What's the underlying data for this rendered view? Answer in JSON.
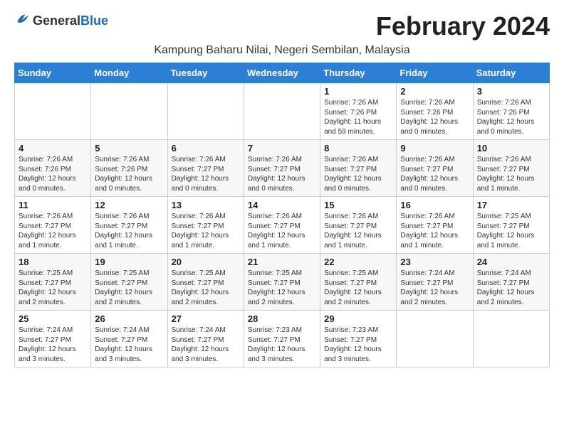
{
  "header": {
    "logo_general": "General",
    "logo_blue": "Blue",
    "month_title": "February 2024",
    "location": "Kampung Baharu Nilai, Negeri Sembilan, Malaysia"
  },
  "days_of_week": [
    "Sunday",
    "Monday",
    "Tuesday",
    "Wednesday",
    "Thursday",
    "Friday",
    "Saturday"
  ],
  "weeks": [
    [
      {
        "day": "",
        "info": ""
      },
      {
        "day": "",
        "info": ""
      },
      {
        "day": "",
        "info": ""
      },
      {
        "day": "",
        "info": ""
      },
      {
        "day": "1",
        "info": "Sunrise: 7:26 AM\nSunset: 7:26 PM\nDaylight: 11 hours\nand 59 minutes."
      },
      {
        "day": "2",
        "info": "Sunrise: 7:26 AM\nSunset: 7:26 PM\nDaylight: 12 hours\nand 0 minutes."
      },
      {
        "day": "3",
        "info": "Sunrise: 7:26 AM\nSunset: 7:26 PM\nDaylight: 12 hours\nand 0 minutes."
      }
    ],
    [
      {
        "day": "4",
        "info": "Sunrise: 7:26 AM\nSunset: 7:26 PM\nDaylight: 12 hours\nand 0 minutes."
      },
      {
        "day": "5",
        "info": "Sunrise: 7:26 AM\nSunset: 7:26 PM\nDaylight: 12 hours\nand 0 minutes."
      },
      {
        "day": "6",
        "info": "Sunrise: 7:26 AM\nSunset: 7:27 PM\nDaylight: 12 hours\nand 0 minutes."
      },
      {
        "day": "7",
        "info": "Sunrise: 7:26 AM\nSunset: 7:27 PM\nDaylight: 12 hours\nand 0 minutes."
      },
      {
        "day": "8",
        "info": "Sunrise: 7:26 AM\nSunset: 7:27 PM\nDaylight: 12 hours\nand 0 minutes."
      },
      {
        "day": "9",
        "info": "Sunrise: 7:26 AM\nSunset: 7:27 PM\nDaylight: 12 hours\nand 0 minutes."
      },
      {
        "day": "10",
        "info": "Sunrise: 7:26 AM\nSunset: 7:27 PM\nDaylight: 12 hours\nand 1 minute."
      }
    ],
    [
      {
        "day": "11",
        "info": "Sunrise: 7:26 AM\nSunset: 7:27 PM\nDaylight: 12 hours\nand 1 minute."
      },
      {
        "day": "12",
        "info": "Sunrise: 7:26 AM\nSunset: 7:27 PM\nDaylight: 12 hours\nand 1 minute."
      },
      {
        "day": "13",
        "info": "Sunrise: 7:26 AM\nSunset: 7:27 PM\nDaylight: 12 hours\nand 1 minute."
      },
      {
        "day": "14",
        "info": "Sunrise: 7:26 AM\nSunset: 7:27 PM\nDaylight: 12 hours\nand 1 minute."
      },
      {
        "day": "15",
        "info": "Sunrise: 7:26 AM\nSunset: 7:27 PM\nDaylight: 12 hours\nand 1 minute."
      },
      {
        "day": "16",
        "info": "Sunrise: 7:26 AM\nSunset: 7:27 PM\nDaylight: 12 hours\nand 1 minute."
      },
      {
        "day": "17",
        "info": "Sunrise: 7:25 AM\nSunset: 7:27 PM\nDaylight: 12 hours\nand 1 minute."
      }
    ],
    [
      {
        "day": "18",
        "info": "Sunrise: 7:25 AM\nSunset: 7:27 PM\nDaylight: 12 hours\nand 2 minutes."
      },
      {
        "day": "19",
        "info": "Sunrise: 7:25 AM\nSunset: 7:27 PM\nDaylight: 12 hours\nand 2 minutes."
      },
      {
        "day": "20",
        "info": "Sunrise: 7:25 AM\nSunset: 7:27 PM\nDaylight: 12 hours\nand 2 minutes."
      },
      {
        "day": "21",
        "info": "Sunrise: 7:25 AM\nSunset: 7:27 PM\nDaylight: 12 hours\nand 2 minutes."
      },
      {
        "day": "22",
        "info": "Sunrise: 7:25 AM\nSunset: 7:27 PM\nDaylight: 12 hours\nand 2 minutes."
      },
      {
        "day": "23",
        "info": "Sunrise: 7:24 AM\nSunset: 7:27 PM\nDaylight: 12 hours\nand 2 minutes."
      },
      {
        "day": "24",
        "info": "Sunrise: 7:24 AM\nSunset: 7:27 PM\nDaylight: 12 hours\nand 2 minutes."
      }
    ],
    [
      {
        "day": "25",
        "info": "Sunrise: 7:24 AM\nSunset: 7:27 PM\nDaylight: 12 hours\nand 3 minutes."
      },
      {
        "day": "26",
        "info": "Sunrise: 7:24 AM\nSunset: 7:27 PM\nDaylight: 12 hours\nand 3 minutes."
      },
      {
        "day": "27",
        "info": "Sunrise: 7:24 AM\nSunset: 7:27 PM\nDaylight: 12 hours\nand 3 minutes."
      },
      {
        "day": "28",
        "info": "Sunrise: 7:23 AM\nSunset: 7:27 PM\nDaylight: 12 hours\nand 3 minutes."
      },
      {
        "day": "29",
        "info": "Sunrise: 7:23 AM\nSunset: 7:27 PM\nDaylight: 12 hours\nand 3 minutes."
      },
      {
        "day": "",
        "info": ""
      },
      {
        "day": "",
        "info": ""
      }
    ]
  ]
}
